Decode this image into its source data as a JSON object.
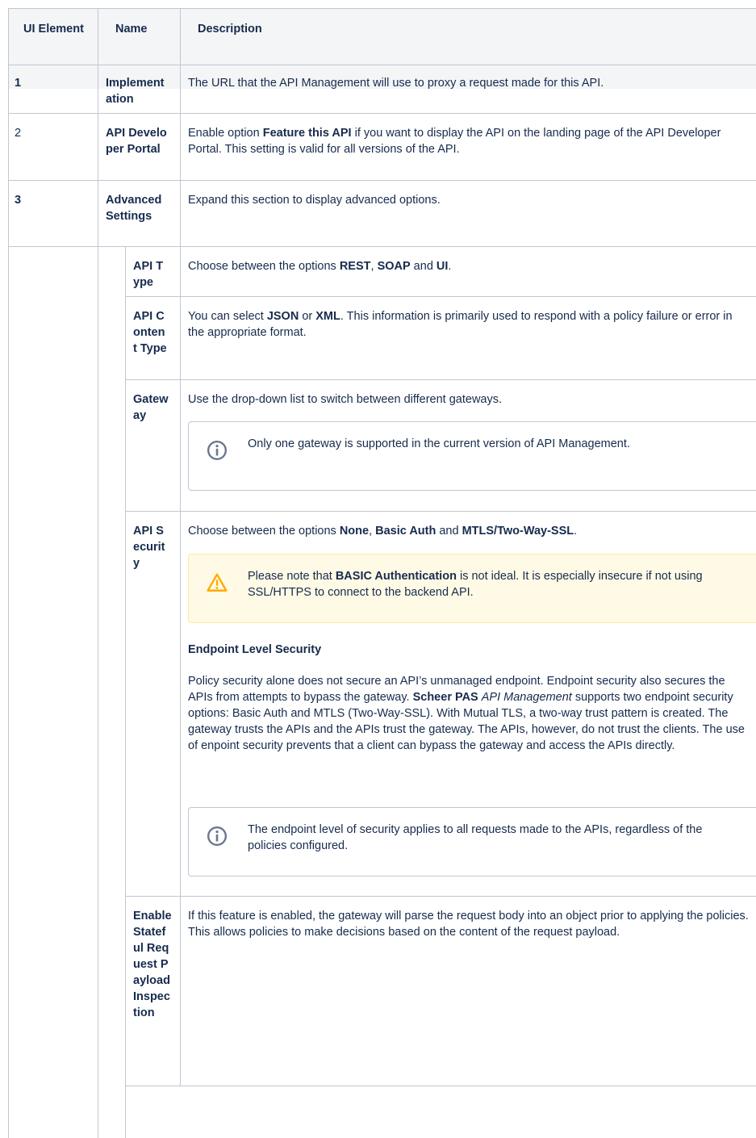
{
  "header": {
    "col1": "UI Element",
    "col2": "Name",
    "col3": "Description"
  },
  "rows": [
    {
      "num": "1",
      "name": "Implementation",
      "desc": "The URL that the API Management will use to proxy a request made for this API."
    },
    {
      "num": "2",
      "name": "API Developer Portal",
      "desc_pre": "Enable option ",
      "desc_bold": "Feature this API",
      "desc_post": " if you want to display the API on the landing page of the API Developer Portal. This setting is valid for all versions of the API."
    },
    {
      "num": "3",
      "name": "Advanced Settings",
      "desc": "Expand this section to display advanced options."
    }
  ],
  "sub": {
    "api_type": {
      "name": "API Type",
      "t1": "Choose between the options ",
      "o1": "REST",
      "t2": ", ",
      "o2": "SOAP",
      "t3": " and ",
      "o3": "UI",
      "t4": "."
    },
    "content_type": {
      "name": "API Content Type",
      "t1": "You can select ",
      "o1": "JSON",
      "t2": " or ",
      "o2": "XML",
      "t3": ". This information is primarily used to respond with a policy failure or error in the appropriate format."
    },
    "gateway": {
      "name": "Gateway",
      "desc": "Use the drop-down list to switch between different gateways.",
      "info": "Only one gateway is supported in the current version of API Management."
    },
    "security": {
      "name": "API Security",
      "t1": "Choose between the options ",
      "o1": "None",
      "t2": ", ",
      "o2": "Basic Auth",
      "t3": " and ",
      "o3": "MTLS/Two-Way-SSL",
      "t4": ".",
      "warn_pre": "Please note that ",
      "warn_bold": "BASIC Authentication",
      "warn_post": " is not ideal. It is especially insecure if not using SSL/HTTPS to connect to the backend API.",
      "heading": "Endpoint Level Security",
      "p1": "Policy security alone does not secure an API’s unmanaged endpoint. Endpoint security also secures the APIs from attempts to bypass the gateway. ",
      "p_bold": "Scheer PAS",
      "p_italic": "API Management",
      "p2": " supports two endpoint security options: Basic Auth and MTLS (Two-Way-SSL). With Mutual TLS, a two-way trust pattern is created. The gateway trusts the APIs and the APIs trust the gateway. The APIs, however, do not trust the clients. The use of enpoint security prevents that a client can bypass the gateway and access the APIs directly.",
      "info": "The endpoint level of security applies to all requests made to the APIs, regardless of the policies configured."
    },
    "stateful": {
      "name": "Enable Stateful Request Payload Inspection",
      "desc": "If this feature is enabled, the gateway will parse the request body into an object prior to applying the policies. This allows policies to make decisions based on the content of the request payload."
    }
  },
  "icons": {
    "info": "info-icon",
    "warning": "warning-icon"
  },
  "colors": {
    "border": "#c1c7d0",
    "header_bg": "#f4f5f7",
    "warn_bg": "#fffae6",
    "warn_border": "#ffe8a3",
    "warn_icon": "#ffab00",
    "info_icon": "#6b778c"
  }
}
